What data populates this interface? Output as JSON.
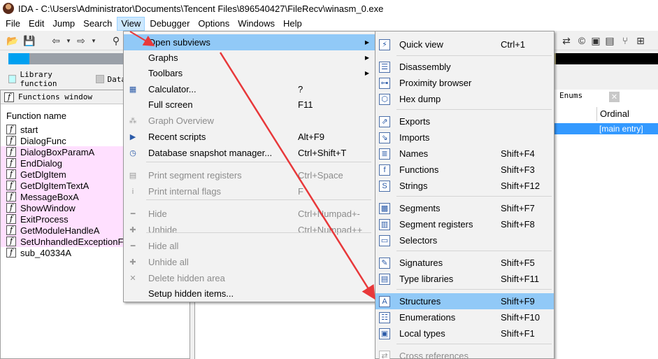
{
  "window": {
    "title": "IDA - C:\\Users\\Administrator\\Documents\\Tencent Files\\896540427\\FileRecv\\winasm_0.exe"
  },
  "menubar": [
    "File",
    "Edit",
    "Jump",
    "Search",
    "View",
    "Debugger",
    "Options",
    "Windows",
    "Help"
  ],
  "legend": {
    "library": "Library function",
    "data": "Data"
  },
  "functions_pane": {
    "tab": "Functions window",
    "column": "Function name",
    "rows": [
      {
        "name": "start",
        "lib": false
      },
      {
        "name": "DialogFunc",
        "lib": false
      },
      {
        "name": "DialogBoxParamA",
        "lib": true
      },
      {
        "name": "EndDialog",
        "lib": true
      },
      {
        "name": "GetDlgItem",
        "lib": true
      },
      {
        "name": "GetDlgItemTextA",
        "lib": true
      },
      {
        "name": "MessageBoxA",
        "lib": true
      },
      {
        "name": "ShowWindow",
        "lib": true
      },
      {
        "name": "ExitProcess",
        "lib": true
      },
      {
        "name": "GetModuleHandleA",
        "lib": true
      },
      {
        "name": "SetUnhandledExceptionFi",
        "lib": true
      },
      {
        "name": "sub_40334A",
        "lib": false
      }
    ]
  },
  "right_pane": {
    "enums_tab": "Enums",
    "ordinal_header": "Ordinal",
    "selected_value": "[main entry]"
  },
  "view_menu": [
    {
      "label": "Open subviews",
      "shortcut": "",
      "submenu": true,
      "highlight": true,
      "disabled": false,
      "icon": "none"
    },
    {
      "label": "Graphs",
      "shortcut": "",
      "submenu": true,
      "disabled": false,
      "icon": "none"
    },
    {
      "label": "Toolbars",
      "shortcut": "",
      "submenu": true,
      "disabled": false,
      "icon": "none"
    },
    {
      "label": "Calculator...",
      "shortcut": "?",
      "disabled": false,
      "icon": "calculator-icon"
    },
    {
      "label": "Full screen",
      "shortcut": "F11",
      "disabled": false,
      "icon": "none"
    },
    {
      "label": "Graph Overview",
      "shortcut": "",
      "disabled": true,
      "icon": "graph-overview-icon"
    },
    {
      "label": "Recent scripts",
      "shortcut": "Alt+F9",
      "disabled": false,
      "icon": "script-icon"
    },
    {
      "label": "Database snapshot manager...",
      "shortcut": "Ctrl+Shift+T",
      "disabled": false,
      "icon": "snapshot-icon"
    },
    {
      "label": "Print segment registers",
      "shortcut": "Ctrl+Space",
      "disabled": true,
      "icon": "segreg-icon"
    },
    {
      "label": "Print internal flags",
      "shortcut": "F",
      "disabled": true,
      "icon": "info-icon"
    },
    {
      "label": "Hide",
      "shortcut": "Ctrl+Numpad+-",
      "disabled": true,
      "icon": "minus-icon"
    },
    {
      "label": "Unhide",
      "shortcut": "Ctrl+Numpad++",
      "disabled": true,
      "icon": "plus-icon"
    },
    {
      "label": "Hide all",
      "shortcut": "",
      "disabled": true,
      "icon": "minus-icon"
    },
    {
      "label": "Unhide all",
      "shortcut": "",
      "disabled": true,
      "icon": "plus-icon"
    },
    {
      "label": "Delete hidden area",
      "shortcut": "",
      "disabled": true,
      "icon": "x-icon"
    },
    {
      "label": "Setup hidden items...",
      "shortcut": "",
      "disabled": false,
      "icon": "none"
    }
  ],
  "subviews_menu": [
    {
      "label": "Quick view",
      "shortcut": "Ctrl+1",
      "icon": "quick-view-icon"
    },
    {
      "label": "Disassembly",
      "shortcut": "",
      "icon": "disassembly-icon"
    },
    {
      "label": "Proximity browser",
      "shortcut": "",
      "icon": "proximity-icon"
    },
    {
      "label": "Hex dump",
      "shortcut": "",
      "icon": "hex-icon"
    },
    {
      "label": "Exports",
      "shortcut": "",
      "icon": "exports-icon"
    },
    {
      "label": "Imports",
      "shortcut": "",
      "icon": "imports-icon"
    },
    {
      "label": "Names",
      "shortcut": "Shift+F4",
      "icon": "names-icon"
    },
    {
      "label": "Functions",
      "shortcut": "Shift+F3",
      "icon": "functions-icon"
    },
    {
      "label": "Strings",
      "shortcut": "Shift+F12",
      "icon": "strings-icon"
    },
    {
      "label": "Segments",
      "shortcut": "Shift+F7",
      "icon": "segments-icon"
    },
    {
      "label": "Segment registers",
      "shortcut": "Shift+F8",
      "icon": "segment-registers-icon"
    },
    {
      "label": "Selectors",
      "shortcut": "",
      "icon": "selectors-icon"
    },
    {
      "label": "Signatures",
      "shortcut": "Shift+F5",
      "icon": "signatures-icon"
    },
    {
      "label": "Type libraries",
      "shortcut": "Shift+F11",
      "icon": "type-libraries-icon"
    },
    {
      "label": "Structures",
      "shortcut": "Shift+F9",
      "highlight": true,
      "icon": "structures-icon"
    },
    {
      "label": "Enumerations",
      "shortcut": "Shift+F10",
      "icon": "enumerations-icon"
    },
    {
      "label": "Local types",
      "shortcut": "Shift+F1",
      "icon": "local-types-icon"
    },
    {
      "label": "Cross references",
      "shortcut": "",
      "disabled": true,
      "icon": "xref-icon"
    }
  ],
  "colors": {
    "highlight": "#91c9f7",
    "library_row": "#ffe0ff",
    "arrow": "#e8383a",
    "selection": "#3399ff"
  }
}
